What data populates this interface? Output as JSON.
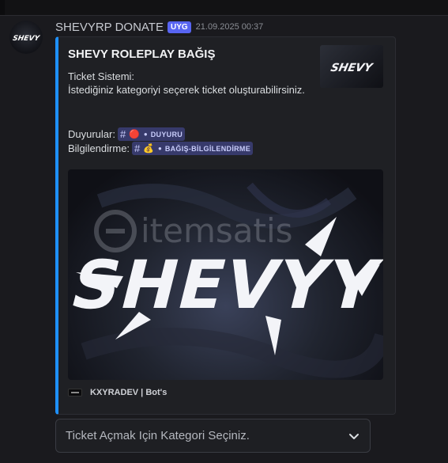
{
  "message": {
    "author": "SHEVYRP DONATE",
    "app_tag": "UYG",
    "timestamp": "21.09.2025 00:37"
  },
  "embed": {
    "title": "SHEVY ROLEPLAY BAĞIŞ",
    "description_line1": "Ticket Sistemi:",
    "description_line2": "İstediğiniz kategoriyi seçerek ticket oluşturabilirsiniz.",
    "channels": [
      {
        "label": "Duyurular:",
        "emoji": "🔴",
        "name": "DUYURU"
      },
      {
        "label": "Bilgilendirme:",
        "emoji": "💰",
        "name": "BAĞIŞ-BİLGİLENDİRME"
      }
    ],
    "image_logo_text": "SHEVYY",
    "image_watermark": "itemsatis",
    "footer_text": "KXYRADEV | Bot's",
    "accent_color": "#1e90ff"
  },
  "select_menu": {
    "placeholder": "Ticket Açmak Için Kategori Seçiniz."
  }
}
